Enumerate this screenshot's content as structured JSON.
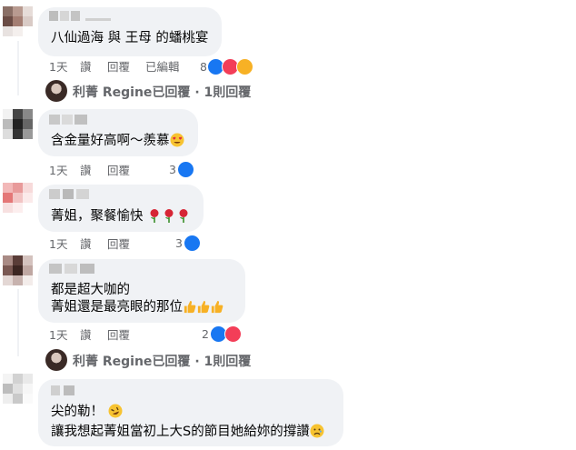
{
  "comments": [
    {
      "text_lines": [
        "八仙過海 與 王母 的蟠桃宴"
      ],
      "meta": {
        "time": "1天",
        "like": "讚",
        "reply": "回覆",
        "edited": "已編輯"
      },
      "reactions": {
        "count": "8",
        "types": [
          "like-icon",
          "love-icon",
          "haha-icon"
        ]
      },
      "reply_summary": {
        "author": "利菁 Regine",
        "replied": "已回覆",
        "sep": "·",
        "count_text": "1則回覆"
      }
    },
    {
      "text_lines": [
        "含金量好高啊～羨慕"
      ],
      "meta": {
        "time": "1天",
        "like": "讚",
        "reply": "回覆"
      },
      "reactions": {
        "count": "3",
        "types": [
          "like-icon"
        ]
      }
    },
    {
      "text_lines": [
        "菁姐，聚餐愉快"
      ],
      "meta": {
        "time": "1天",
        "like": "讚",
        "reply": "回覆"
      },
      "reactions": {
        "count": "3",
        "types": [
          "like-icon"
        ]
      }
    },
    {
      "text_lines": [
        "都是超大咖的",
        "菁姐還是最亮眼的那位"
      ],
      "meta": {
        "time": "1天",
        "like": "讚",
        "reply": "回覆"
      },
      "reactions": {
        "count": "2",
        "types": [
          "like-icon",
          "love-icon"
        ]
      },
      "reply_summary": {
        "author": "利菁 Regine",
        "replied": "已回覆",
        "sep": "·",
        "count_text": "1則回覆"
      }
    },
    {
      "text_lines": [
        "尖的勒！",
        "讓我想起菁姐當初上大S的節目她給妳的撐讚"
      ]
    }
  ],
  "colors": {
    "bubble": "#f0f2f5",
    "meta": "#65676b",
    "text": "#050505",
    "like": "#1877f2",
    "love": "#f33e58",
    "haha": "#f7b125"
  }
}
